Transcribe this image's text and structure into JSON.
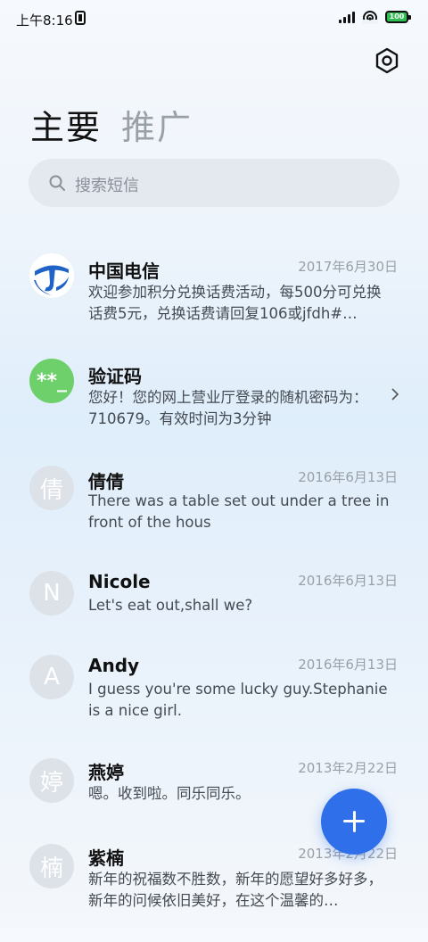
{
  "status_bar": {
    "time": "上午8:16",
    "battery": "100"
  },
  "tabs": [
    {
      "label": "主要"
    },
    {
      "label": "推广"
    }
  ],
  "search": {
    "placeholder": "搜索短信"
  },
  "conversations": [
    {
      "name": "中国电信",
      "date": "2017年6月30日",
      "preview": "欢迎参加积分兑换话费活动，每500分可兑换话费5元，兑换话费请回复106或jfdh#…",
      "avatar": "telecom-logo"
    },
    {
      "name": "验证码",
      "date": "",
      "preview": "您好！您的网上营业厅登录的随机密码为：710679。有效时间为3分钟",
      "avatar": "**_"
    },
    {
      "name": "倩倩",
      "date": "2016年6月13日",
      "preview": "There was a table set out under a tree in front of the hous",
      "avatar": "倩"
    },
    {
      "name": "Nicole",
      "date": "2016年6月13日",
      "preview": "Let's eat out,shall we?",
      "avatar": "N"
    },
    {
      "name": "Andy",
      "date": "2016年6月13日",
      "preview": "I guess you're some lucky guy.Stephanie is a nice girl.",
      "avatar": "A"
    },
    {
      "name": "燕婷",
      "date": "2013年2月22日",
      "preview": "嗯。收到啦。同乐同乐。",
      "avatar": "婷"
    },
    {
      "name": "紫楠",
      "date": "2013年2月22日",
      "preview": "新年的祝福数不胜数，新年的愿望好多好多，新年的问候依旧美好，在这个温馨的…",
      "avatar": "楠"
    }
  ],
  "colors": {
    "accent": "#2f6fe9",
    "verify_avatar": "#6dd06a",
    "telecom_blue": "#1f63c8"
  }
}
